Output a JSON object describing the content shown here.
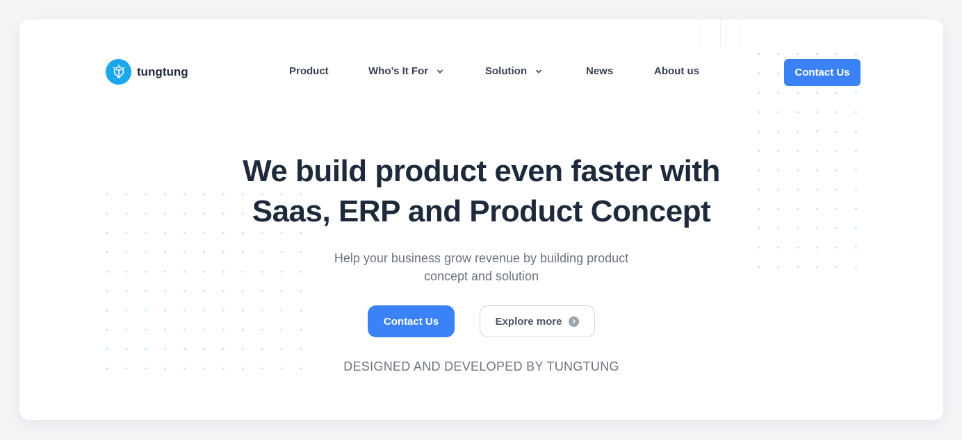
{
  "brand": {
    "name": "tungtung",
    "icon": "lightbulb-icon",
    "color": "#1aa7ec"
  },
  "nav": {
    "items": [
      {
        "label": "Product",
        "has_dropdown": false
      },
      {
        "label": "Who’s It For",
        "has_dropdown": true
      },
      {
        "label": "Solution",
        "has_dropdown": true
      },
      {
        "label": "News",
        "has_dropdown": false
      },
      {
        "label": "About us",
        "has_dropdown": false
      }
    ],
    "cta_label": "Contact Us"
  },
  "hero": {
    "title_line1": "We build product even faster with",
    "title_line2": "Saas, ERP and Product Concept",
    "subtitle_line1": "Help your business grow revenue by building product",
    "subtitle_line2": "concept and solution",
    "primary_label": "Contact Us",
    "secondary_label": "Explore more",
    "secondary_icon": "chevron-right-circle-icon",
    "credit": "DESIGNED AND DEVELOPED BY TUNGTUNG"
  },
  "colors": {
    "accent": "#3b82f6",
    "heading": "#1e293b",
    "muted": "#6b7280",
    "dot_pattern": "#b7ece8"
  }
}
